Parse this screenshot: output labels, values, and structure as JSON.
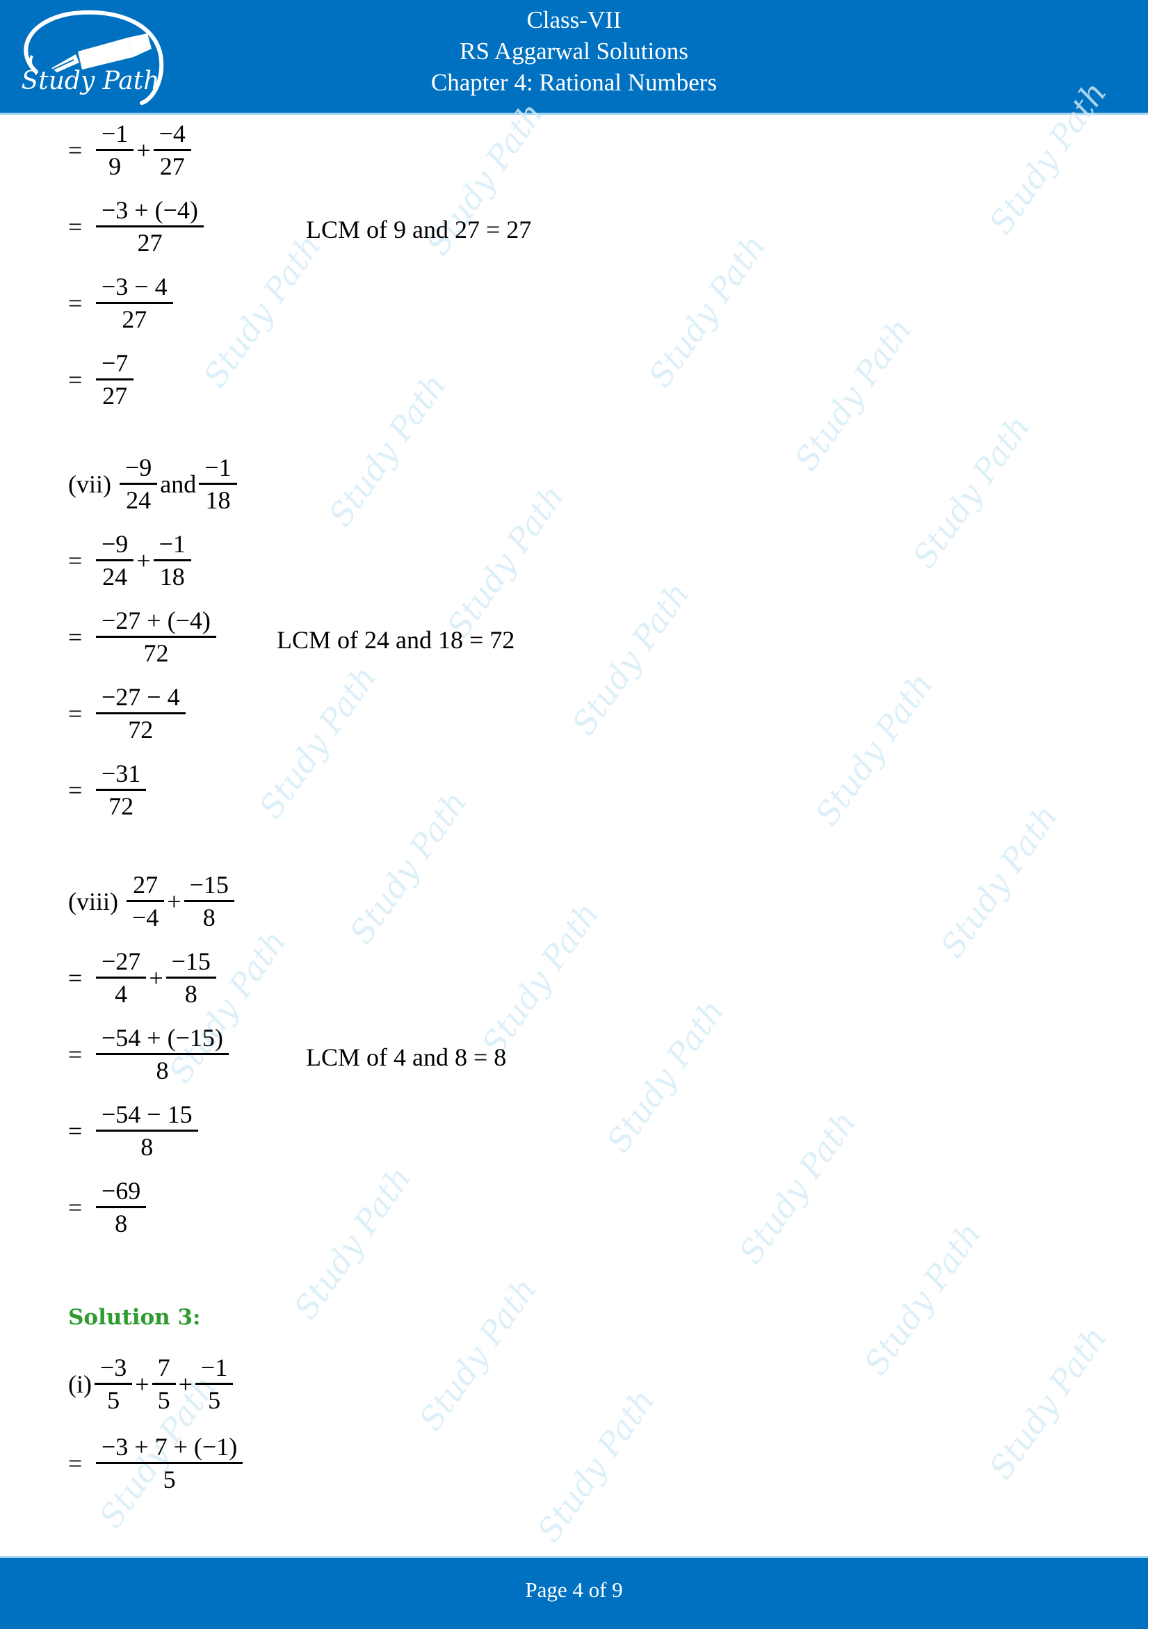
{
  "header": {
    "logo_text": "Study Path",
    "line1": "Class-VII",
    "line2": "RS Aggarwal Solutions",
    "line3": "Chapter 4: Rational Numbers"
  },
  "watermark_text": "Study Path",
  "part_vi_cont": {
    "step1": {
      "a_num": "−1",
      "a_den": "9",
      "op": "+",
      "b_num": "−4",
      "b_den": "27"
    },
    "step2": {
      "num": "−3 + (−4)",
      "den": "27"
    },
    "step2_note": "LCM of  9 and 27 = 27",
    "step3": {
      "num": "−3 − 4",
      "den": "27"
    },
    "step4": {
      "num": "−7",
      "den": "27"
    }
  },
  "part_vii": {
    "label": "(vii)",
    "q": {
      "a_num": "−9",
      "a_den": "24",
      "joiner": "and",
      "b_num": "−1",
      "b_den": "18"
    },
    "step1": {
      "a_num": "−9",
      "a_den": "24",
      "op": "+",
      "b_num": "−1",
      "b_den": "18"
    },
    "step2": {
      "num": "−27 + (−4)",
      "den": "72"
    },
    "step2_note": "LCM of  24 and 18 = 72",
    "step3": {
      "num": "−27 − 4",
      "den": "72"
    },
    "step4": {
      "num": "−31",
      "den": "72"
    }
  },
  "part_viii": {
    "label": "(viii)",
    "q": {
      "a_num": "27",
      "a_den": "−4",
      "op": "+",
      "b_num": "−15",
      "b_den": "8"
    },
    "step1": {
      "a_num": "−27",
      "a_den": "4",
      "op": "+",
      "b_num": "−15",
      "b_den": "8"
    },
    "step2": {
      "num": "−54 + (−15)",
      "den": "8"
    },
    "step2_note": "LCM of  4 and 8 = 8",
    "step3": {
      "num": "−54 − 15",
      "den": "8"
    },
    "step4": {
      "num": "−69",
      "den": "8"
    }
  },
  "solution3": {
    "heading": "Solution 3:",
    "part_i": {
      "label": "(i)",
      "q": {
        "a_num": "−3",
        "a_den": "5",
        "op1": "+",
        "b_num": "7",
        "b_den": "5",
        "op2": "+",
        "c_num": "−1",
        "c_den": "5"
      },
      "step1": {
        "num": "−3 + 7 + (−1)",
        "den": "5"
      }
    }
  },
  "equals": "=",
  "footer": {
    "page_text": "Page 4 of 9"
  }
}
